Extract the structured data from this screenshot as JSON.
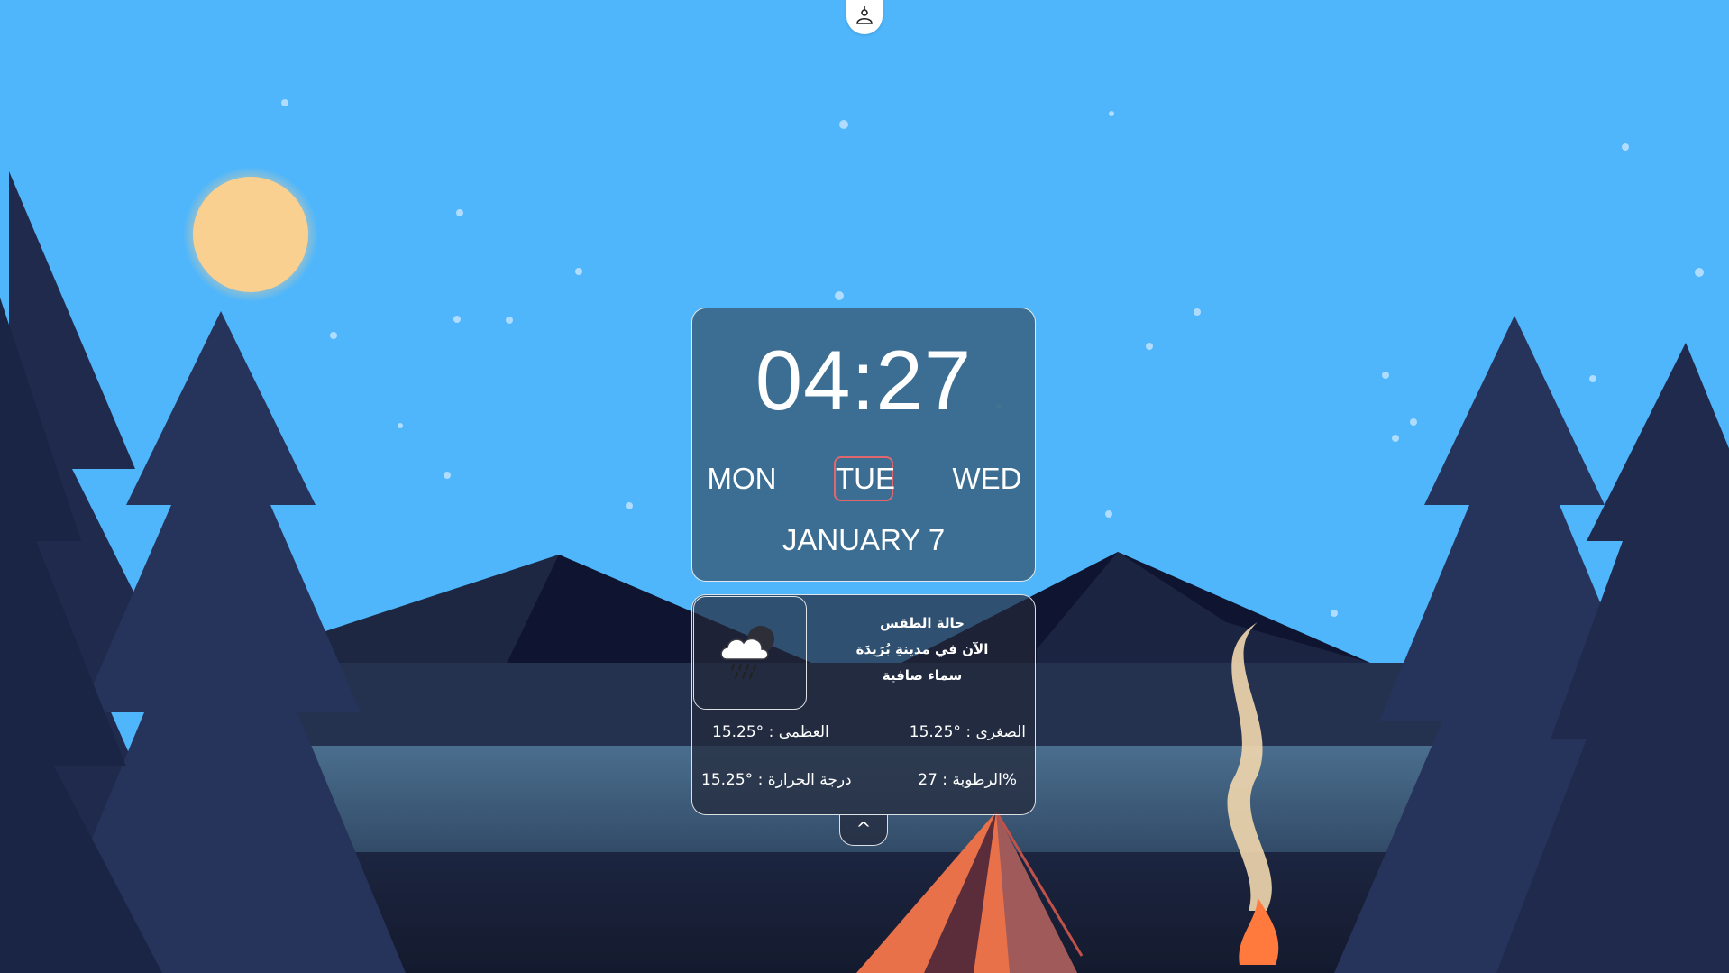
{
  "theme": {
    "sky": "#4fb6fb",
    "sun": "#fad090",
    "card_bg": "#3a688a",
    "selected_day_border": "#e0676d"
  },
  "top_button": {
    "icon": "user-icon"
  },
  "clock": {
    "time": "04:27",
    "days": {
      "prev": "MON",
      "current": "TUE",
      "next": "WED"
    },
    "date": "JANUARY 7"
  },
  "weather": {
    "icon": "rain-cloud-icon",
    "title": "حالة الطقس",
    "city_line": "الآن في مدينةِ بُرَيدَة",
    "description": "سماء صافية",
    "min": "الصغرى : °15.25",
    "max": "العظمى : °15.25",
    "humidity": "الرطوبة : 27%",
    "temperature": "درجة الحرارة : °15.25"
  },
  "toggle": {
    "label": "^"
  }
}
